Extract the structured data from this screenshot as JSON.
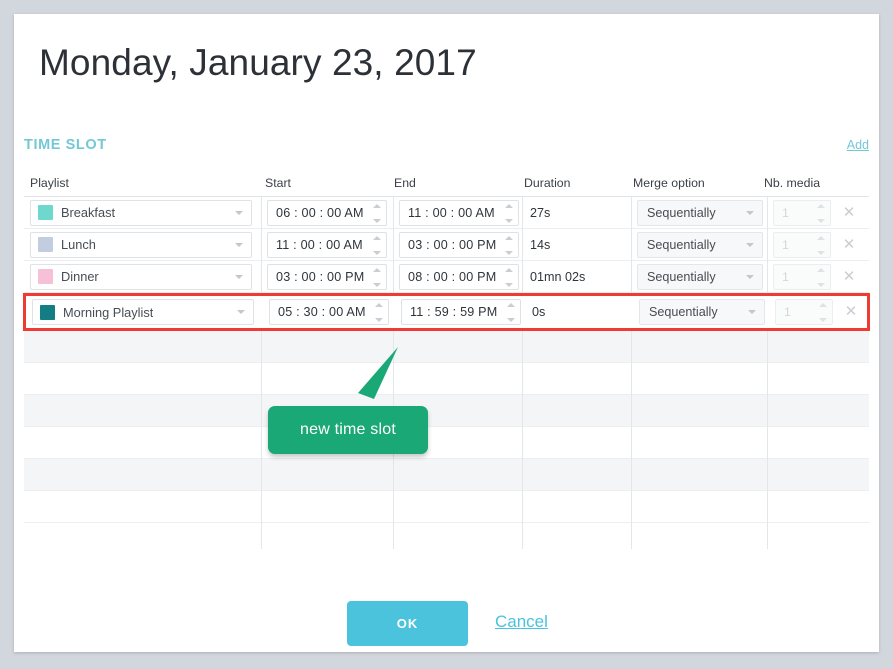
{
  "page": {
    "title": "Monday, January 23, 2017"
  },
  "section": {
    "title": "TIME SLOT",
    "add_label": "Add"
  },
  "table": {
    "headers": {
      "playlist": "Playlist",
      "start": "Start",
      "end": "End",
      "duration": "Duration",
      "merge": "Merge option",
      "nb_media": "Nb. media"
    },
    "rows": [
      {
        "playlist": "Breakfast",
        "swatch_color": "#6ed8cf",
        "start": "06 : 00 : 00 AM",
        "end": "11 : 00 : 00 AM",
        "duration": "27s",
        "merge": "Sequentially",
        "nb_media": "1",
        "delete_label": "✕"
      },
      {
        "playlist": "Lunch",
        "swatch_color": "#c2cde0",
        "start": "11 : 00 : 00 AM",
        "end": "03 : 00 : 00 PM",
        "duration": "14s",
        "merge": "Sequentially",
        "nb_media": "1",
        "delete_label": "✕"
      },
      {
        "playlist": "Dinner",
        "swatch_color": "#f6c1d6",
        "start": "03 : 00 : 00 PM",
        "end": "08 : 00 : 00 PM",
        "duration": "01mn 02s",
        "merge": "Sequentially",
        "nb_media": "1",
        "delete_label": "✕"
      },
      {
        "playlist": "Morning Playlist",
        "swatch_color": "#127d83",
        "start": "05 : 30 : 00 AM",
        "end": "11 : 59 : 59 PM",
        "duration": "0s",
        "merge": "Sequentially",
        "nb_media": "1",
        "delete_label": "✕",
        "highlighted": true
      }
    ],
    "empty_row_count": 6
  },
  "annotation": {
    "callout_text": "new time slot",
    "callout_color": "#1aa877",
    "highlight_color": "#ee3b33"
  },
  "footer": {
    "ok_label": "OK",
    "cancel_label": "Cancel"
  }
}
